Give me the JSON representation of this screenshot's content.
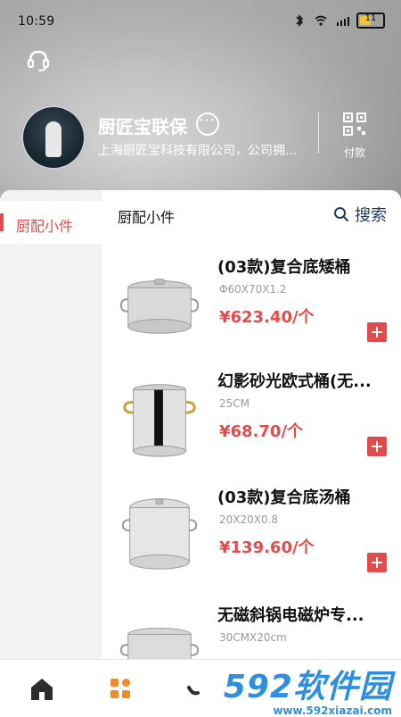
{
  "status_bar": {
    "time": "10:59",
    "battery_level": "11"
  },
  "store": {
    "name": "厨匠宝联保",
    "description": "上海厨匠宝科技有限公司，公司拥...",
    "pay_label": "付款"
  },
  "sidebar": {
    "items": [
      {
        "label": "厨配小件",
        "active": true
      }
    ]
  },
  "content": {
    "title": "厨配小件",
    "search_label": "搜索"
  },
  "products": [
    {
      "name": "(03款)复合底矮桶",
      "spec": "Φ60X70X1.2",
      "price": "¥623.40/个",
      "icon": "stock-pot-icon"
    },
    {
      "name": "幻影砂光欧式桶(无...",
      "spec": "25CM",
      "price": "¥68.70/个",
      "icon": "stock-pot-icon"
    },
    {
      "name": "(03款)复合底汤桶",
      "spec": "20X20X0.8",
      "price": "¥139.60/个",
      "icon": "stock-pot-icon"
    },
    {
      "name": "无磁斜锅电磁炉专...",
      "spec": "30CMX20cm",
      "price": "",
      "icon": "stock-pot-icon"
    }
  ],
  "bottom_nav": {
    "items": [
      {
        "name": "home",
        "icon": "home-icon"
      },
      {
        "name": "category",
        "icon": "grid-icon"
      },
      {
        "name": "other",
        "icon": "partial-icon"
      }
    ]
  },
  "watermark": {
    "brand_num": "592",
    "brand_cn": "软件园",
    "url": "www.592xiazai.com"
  },
  "colors": {
    "accent": "#e34b4b",
    "watermark": "#2e8fe0"
  }
}
